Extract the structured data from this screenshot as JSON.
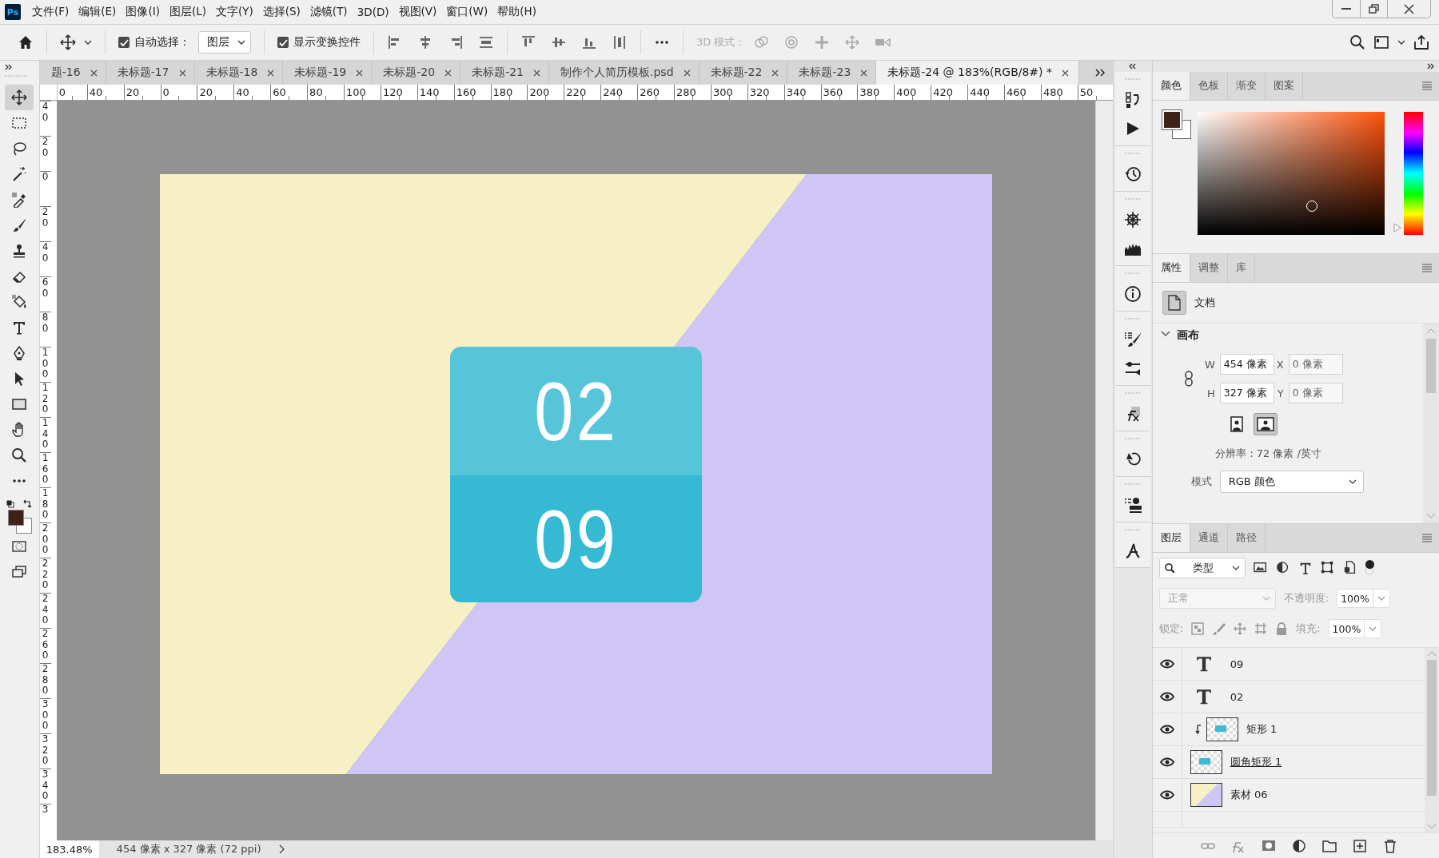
{
  "app": {
    "logo": "Ps"
  },
  "menu": [
    "文件(F)",
    "编辑(E)",
    "图像(I)",
    "图层(L)",
    "文字(Y)",
    "选择(S)",
    "滤镜(T)",
    "3D(D)",
    "视图(V)",
    "窗口(W)",
    "帮助(H)"
  ],
  "options_bar": {
    "auto_select": {
      "label": "自动选择：",
      "checked": true
    },
    "target": "图层",
    "show_transform": {
      "label": "显示变换控件",
      "checked": true
    },
    "mode_3d": "3D 模式："
  },
  "tabs": [
    {
      "label": "题-16",
      "selected": false
    },
    {
      "label": "未标题-17",
      "selected": false
    },
    {
      "label": "未标题-18",
      "selected": false
    },
    {
      "label": "未标题-19",
      "selected": false
    },
    {
      "label": "未标题-20",
      "selected": false
    },
    {
      "label": "未标题-21",
      "selected": false
    },
    {
      "label": "制作个人简历模板.psd",
      "selected": false
    },
    {
      "label": "未标题-22",
      "selected": false
    },
    {
      "label": "未标题-23",
      "selected": false
    },
    {
      "label": "未标题-24 @ 183%(RGB/8#) *",
      "selected": true
    }
  ],
  "tools": [
    {
      "kind": "move",
      "selected": true
    },
    {
      "kind": "marquee",
      "selected": false
    },
    {
      "kind": "lasso",
      "selected": false
    },
    {
      "kind": "wand",
      "selected": false
    },
    {
      "kind": "eyedropper",
      "selected": false
    },
    {
      "kind": "brush",
      "selected": false
    },
    {
      "kind": "stamp",
      "selected": false
    },
    {
      "kind": "eraser",
      "selected": false
    },
    {
      "kind": "bucket",
      "selected": false
    },
    {
      "kind": "type",
      "selected": false
    },
    {
      "kind": "pen",
      "selected": false
    },
    {
      "kind": "arrow",
      "selected": false
    },
    {
      "kind": "rectangle",
      "selected": false
    },
    {
      "kind": "hand",
      "selected": false
    },
    {
      "kind": "zoom",
      "selected": false
    },
    {
      "kind": "more",
      "selected": false
    }
  ],
  "rulers": {
    "horizontal": [
      "0",
      "40",
      "20",
      "0",
      "20",
      "40",
      "60",
      "80",
      "100",
      "120",
      "140",
      "160",
      "180",
      "200",
      "220",
      "240",
      "260",
      "280",
      "300",
      "320",
      "340",
      "360",
      "380",
      "400",
      "420",
      "440",
      "460",
      "480",
      "50"
    ],
    "vertical": [
      "40",
      "20",
      "0",
      "20",
      "40",
      "60",
      "80",
      "100",
      "120",
      "140",
      "160",
      "180",
      "200",
      "220",
      "240",
      "260",
      "280",
      "300",
      "320",
      "340",
      "3"
    ]
  },
  "document": {
    "numbers": [
      "02",
      "09"
    ]
  },
  "status_bar": {
    "zoom": "183.48%",
    "info": "454 像素 x 327 像素 (72 ppi)"
  },
  "color_panel": {
    "hue_slider": {
      "level": 0.06
    },
    "tabs": [
      {
        "label": "颜色",
        "selected": true
      },
      {
        "label": "色板",
        "selected": false
      },
      {
        "label": "渐变",
        "selected": false
      },
      {
        "label": "图案",
        "selected": false
      }
    ]
  },
  "properties_panel": {
    "tabs": [
      {
        "label": "属性",
        "selected": true
      },
      {
        "label": "调整",
        "selected": false
      },
      {
        "label": "库",
        "selected": false
      }
    ],
    "type": "文档",
    "section": {
      "title": "画布",
      "expanded": true
    },
    "fields": [
      {
        "label": "W",
        "value": "454 像素"
      },
      {
        "label": "X",
        "value": "0 像素"
      },
      {
        "label": "H",
        "value": "327 像素"
      },
      {
        "label": "Y",
        "value": "0 像素"
      }
    ],
    "orientation": [
      {
        "kind": "portrait",
        "selected": false
      },
      {
        "kind": "landscape",
        "selected": true
      }
    ],
    "resolution": "分辨率：72 像素 /英寸",
    "mode": {
      "label": "模式",
      "value": "RGB 颜色"
    }
  },
  "layers_panel": {
    "tabs": [
      {
        "label": "图层",
        "selected": true
      },
      {
        "label": "通道",
        "selected": false
      },
      {
        "label": "路径",
        "selected": false
      }
    ],
    "filter": "类型",
    "blend_mode": {
      "value": "正常",
      "disabled": true
    },
    "opacity": {
      "label": "不透明度:",
      "value": "100%"
    },
    "lock_label": "锁定:",
    "fill": {
      "label": "填充:",
      "value": "100%"
    },
    "layers": [
      {
        "kind": "text",
        "name": "09",
        "visible": true,
        "clipped": false,
        "clip_base": false
      },
      {
        "kind": "text",
        "name": "02",
        "visible": true,
        "clipped": false,
        "clip_base": false
      },
      {
        "kind": "shape",
        "name": "矩形 1",
        "visible": true,
        "clipped": true,
        "clip_base": false
      },
      {
        "kind": "shape",
        "name": "圆角矩形 1",
        "visible": true,
        "clipped": false,
        "clip_base": true
      },
      {
        "kind": "image",
        "name": "素材 06",
        "visible": true,
        "clipped": false,
        "clip_base": false
      }
    ]
  }
}
